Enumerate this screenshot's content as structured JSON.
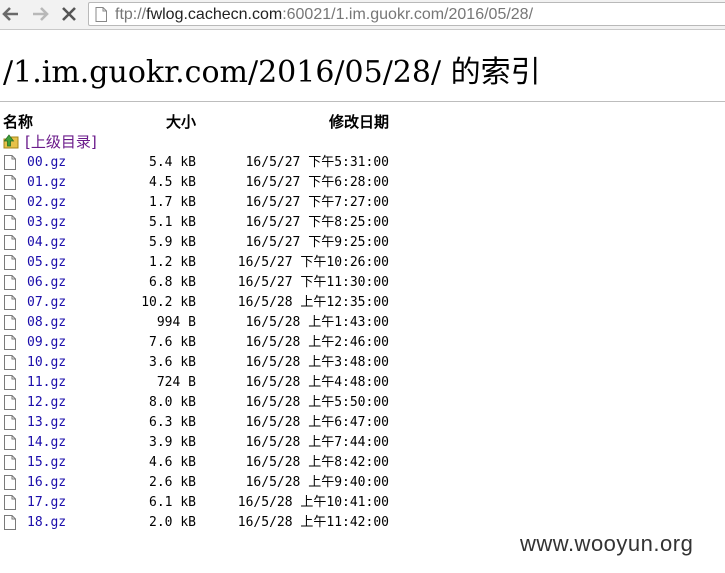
{
  "browser": {
    "url_scheme": "ftp://",
    "url_host": "fwlog.cachecn.com",
    "url_rest": ":60021/1.im.guokr.com/2016/05/28/"
  },
  "page": {
    "title": "/1.im.guokr.com/2016/05/28/ 的索引",
    "headers": {
      "name": "名称",
      "size": "大小",
      "date": "修改日期"
    },
    "parent_link": "[上级目录]",
    "files": [
      {
        "name": "00.gz",
        "size": "5.4 kB",
        "date": "16/5/27 下午5:31:00"
      },
      {
        "name": "01.gz",
        "size": "4.5 kB",
        "date": "16/5/27 下午6:28:00"
      },
      {
        "name": "02.gz",
        "size": "1.7 kB",
        "date": "16/5/27 下午7:27:00"
      },
      {
        "name": "03.gz",
        "size": "5.1 kB",
        "date": "16/5/27 下午8:25:00"
      },
      {
        "name": "04.gz",
        "size": "5.9 kB",
        "date": "16/5/27 下午9:25:00"
      },
      {
        "name": "05.gz",
        "size": "1.2 kB",
        "date": "16/5/27 下午10:26:00"
      },
      {
        "name": "06.gz",
        "size": "6.8 kB",
        "date": "16/5/27 下午11:30:00"
      },
      {
        "name": "07.gz",
        "size": "10.2 kB",
        "date": "16/5/28 上午12:35:00"
      },
      {
        "name": "08.gz",
        "size": "994 B",
        "date": "16/5/28 上午1:43:00"
      },
      {
        "name": "09.gz",
        "size": "7.6 kB",
        "date": "16/5/28 上午2:46:00"
      },
      {
        "name": "10.gz",
        "size": "3.6 kB",
        "date": "16/5/28 上午3:48:00"
      },
      {
        "name": "11.gz",
        "size": "724 B",
        "date": "16/5/28 上午4:48:00"
      },
      {
        "name": "12.gz",
        "size": "8.0 kB",
        "date": "16/5/28 上午5:50:00"
      },
      {
        "name": "13.gz",
        "size": "6.3 kB",
        "date": "16/5/28 上午6:47:00"
      },
      {
        "name": "14.gz",
        "size": "3.9 kB",
        "date": "16/5/28 上午7:44:00"
      },
      {
        "name": "15.gz",
        "size": "4.6 kB",
        "date": "16/5/28 上午8:42:00"
      },
      {
        "name": "16.gz",
        "size": "2.6 kB",
        "date": "16/5/28 上午9:40:00"
      },
      {
        "name": "17.gz",
        "size": "6.1 kB",
        "date": "16/5/28 上午10:41:00"
      },
      {
        "name": "18.gz",
        "size": "2.0 kB",
        "date": "16/5/28 上午11:42:00"
      }
    ]
  },
  "watermark": "www.wooyun.org",
  "icons": {
    "back": "back-arrow-icon",
    "forward": "forward-arrow-icon",
    "stop": "close-icon",
    "page": "page-icon",
    "parent": "folder-up-icon",
    "file": "file-icon"
  },
  "colors": {
    "link": "#1a0dab",
    "visited_link": "#6a1a8a",
    "toolbar": "#f2f2f2"
  }
}
